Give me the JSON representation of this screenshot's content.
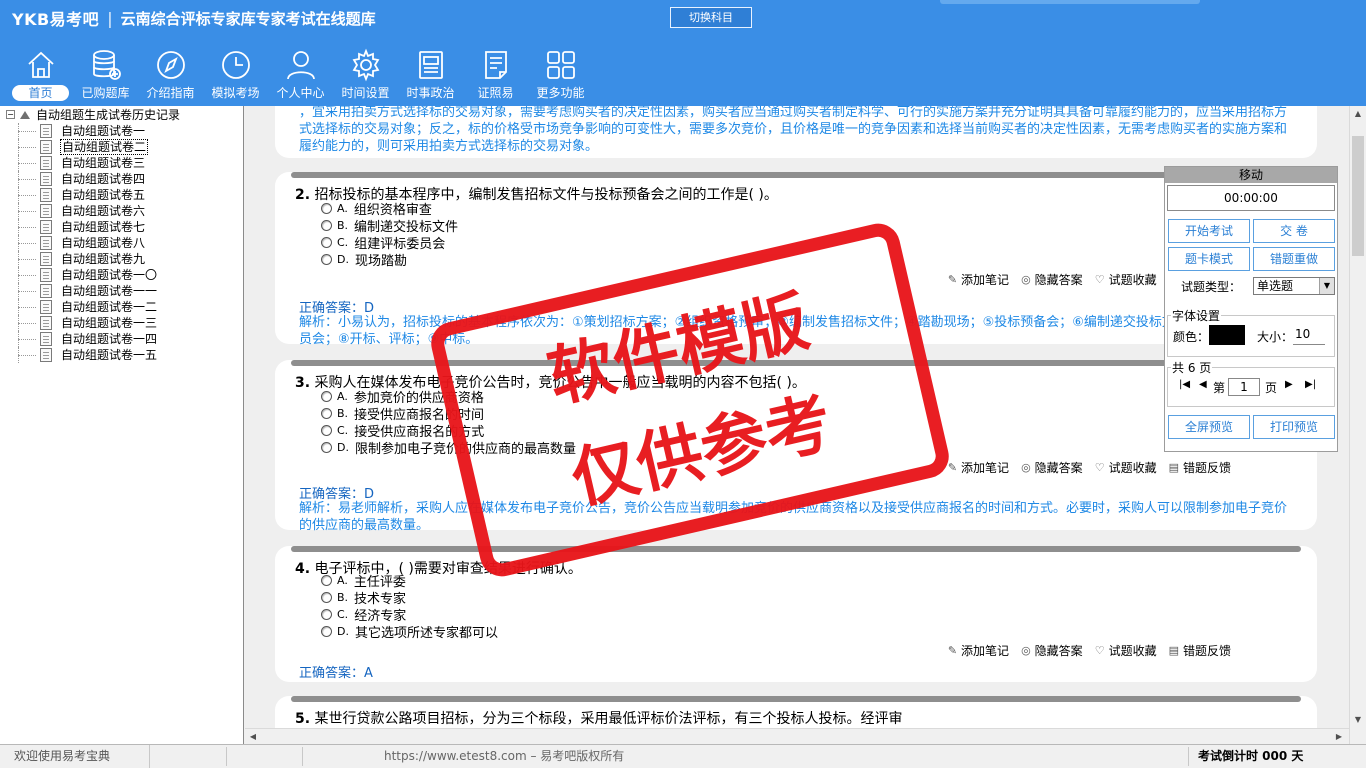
{
  "header": {
    "logo": "YKB易考吧",
    "separator": "|",
    "app_title": "云南综合评标专家库专家考试在线题库",
    "switch_subject": "切换科目"
  },
  "nav": [
    {
      "label": "首页",
      "icon": "home-icon"
    },
    {
      "label": "已购题库",
      "icon": "database-icon"
    },
    {
      "label": "介绍指南",
      "icon": "compass-icon"
    },
    {
      "label": "模拟考场",
      "icon": "clock-icon"
    },
    {
      "label": "个人中心",
      "icon": "user-icon"
    },
    {
      "label": "时间设置",
      "icon": "gear-icon"
    },
    {
      "label": "时事政治",
      "icon": "newspaper-icon"
    },
    {
      "label": "证照易",
      "icon": "certificate-icon"
    },
    {
      "label": "更多功能",
      "icon": "grid-icon"
    }
  ],
  "tree": {
    "expander": "−",
    "root": "自动组题生成试卷历史记录",
    "items": [
      "自动组题试卷一",
      "自动组题试卷二",
      "自动组题试卷三",
      "自动组题试卷四",
      "自动组题试卷五",
      "自动组题试卷六",
      "自动组题试卷七",
      "自动组题试卷八",
      "自动组题试卷九",
      "自动组题试卷一〇",
      "自动组题试卷一一",
      "自动组题试卷一二",
      "自动组题试卷一三",
      "自动组题试卷一四",
      "自动组题试卷一五"
    ]
  },
  "actions": {
    "note": "添加笔记",
    "hide": "隐藏答案",
    "favorite": "试题收藏",
    "feedback": "错题反馈"
  },
  "answer_prefix": "正确答案：",
  "q1_tail": "，宜采用拍卖方式选择标的交易对象，需要考虑购买者的决定性因素，购买者应当通过购买者制定科学、可行的实施方案并充分证明其具备可靠履约能力的，应当采用招标方式选择标的交易对象；反之，标的价格受市场竞争影响的可变性大，需要多次竞价，且价格是唯一的竞争因素和选择当前购买者的决定性因素，无需考虑购买者的实施方案和履约能力的，则可采用拍卖方式选择标的交易对象。",
  "questions": [
    {
      "num": "2.",
      "text": "招标投标的基本程序中，编制发售招标文件与投标预备会之间的工作是(  )。",
      "options": [
        {
          "l": "A.",
          "t": "组织资格审查"
        },
        {
          "l": "B.",
          "t": "编制递交投标文件"
        },
        {
          "l": "C.",
          "t": "组建评标委员会"
        },
        {
          "l": "D.",
          "t": "现场踏勘"
        }
      ],
      "answer": "D",
      "explain": "解析：小易认为，招标投标的基本程序依次为：①策划招标方案；②组织资格预审；③编制发售招标文件；④踏勘现场；⑤投标预备会；⑥编制递交投标文件；⑦组建评标委员会；⑧开标、评标；⑨中标。"
    },
    {
      "num": "3.",
      "text": "采购人在媒体发布电子竞价公告时，竞价公告中一般应当载明的内容不包括(  )。",
      "options": [
        {
          "l": "A.",
          "t": "参加竞价的供应商资格"
        },
        {
          "l": "B.",
          "t": "接受供应商报名的时间"
        },
        {
          "l": "C.",
          "t": "接受供应商报名的方式"
        },
        {
          "l": "D.",
          "t": "限制参加电子竞价的供应商的最高数量"
        }
      ],
      "answer": "D",
      "explain": "解析：易老师解析，采购人应在媒体发布电子竞价公告，竞价公告应当载明参加竞价的供应商资格以及接受供应商报名的时间和方式。必要时，采购人可以限制参加电子竞价的供应商的最高数量。"
    },
    {
      "num": "4.",
      "text": "电子评标中，(  )需要对审查结果进行确认。",
      "options": [
        {
          "l": "A.",
          "t": "主任评委"
        },
        {
          "l": "B.",
          "t": "技术专家"
        },
        {
          "l": "C.",
          "t": "经济专家"
        },
        {
          "l": "D.",
          "t": "其它选项所述专家都可以"
        }
      ],
      "answer": "A"
    }
  ],
  "q5_text": "某世行贷款公路项目招标，分为三个标段，采用最低评标价法评标，有三个投标人投标。经评审",
  "panel": {
    "title": "移动",
    "timer": "00:00:00",
    "start": "开始考试",
    "submit": "交    卷",
    "card_mode": "题卡模式",
    "wrong_redo": "错题重做",
    "type_label": "试题类型：",
    "type_value": "单选题",
    "font_group": "字体设置",
    "color_label": "颜色：",
    "size_label": "大小：",
    "size_value": "10",
    "pages_group": "共 6 页",
    "page_prefix": "第",
    "page_value": "1",
    "page_suffix": "页",
    "fullscreen": "全屏预览",
    "print": "打印预览"
  },
  "watermark": {
    "line1": "软件模版",
    "line2": "仅供参考"
  },
  "status": {
    "welcome": "欢迎使用易考宝典",
    "copyright": "https://www.etest8.com – 易考吧版权所有",
    "countdown": "考试倒计时 000 天"
  }
}
